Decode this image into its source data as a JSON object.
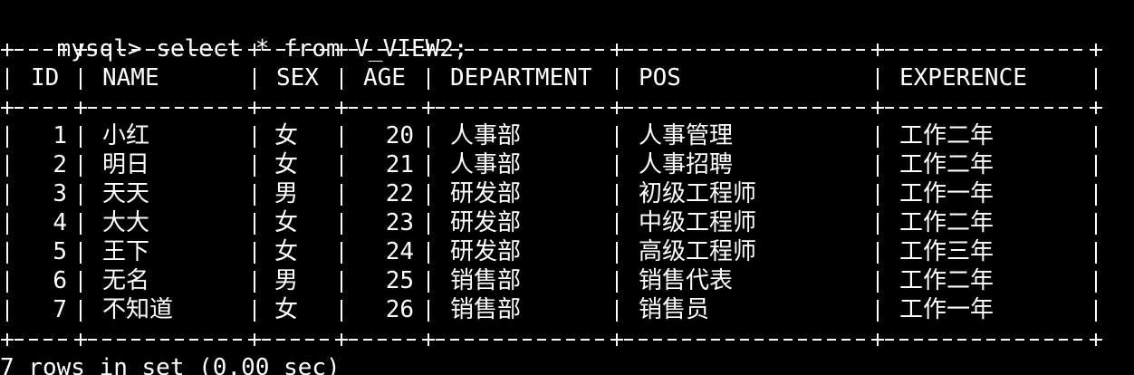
{
  "terminal": {
    "prompt": "mysql> ",
    "command": "select * from V_VIEW2;",
    "border_line": "+----+-----------+-----+-----+------------+-----------------+------------+",
    "columns": [
      "ID",
      "NAME",
      "SEX",
      "AGE",
      "DEPARTMENT",
      "POS",
      "EXPERENCE"
    ],
    "rows": [
      [
        "1",
        "小红",
        "女",
        "20",
        "人事部",
        "人事管理",
        "工作二年"
      ],
      [
        "2",
        "明日",
        "女",
        "21",
        "人事部",
        "人事招聘",
        "工作二年"
      ],
      [
        "3",
        "天天",
        "男",
        "22",
        "研发部",
        "初级工程师",
        "工作一年"
      ],
      [
        "4",
        "大大",
        "女",
        "23",
        "研发部",
        "中级工程师",
        "工作二年"
      ],
      [
        "5",
        "王下",
        "女",
        "24",
        "研发部",
        "高级工程师",
        "工作三年"
      ],
      [
        "6",
        "无名",
        "男",
        "25",
        "销售部",
        "销售代表",
        "工作二年"
      ],
      [
        "7",
        "不知道",
        "女",
        "26",
        "销售部",
        "销售员",
        "工作一年"
      ]
    ],
    "footer": "7 rows in set (0.00 sec)"
  }
}
